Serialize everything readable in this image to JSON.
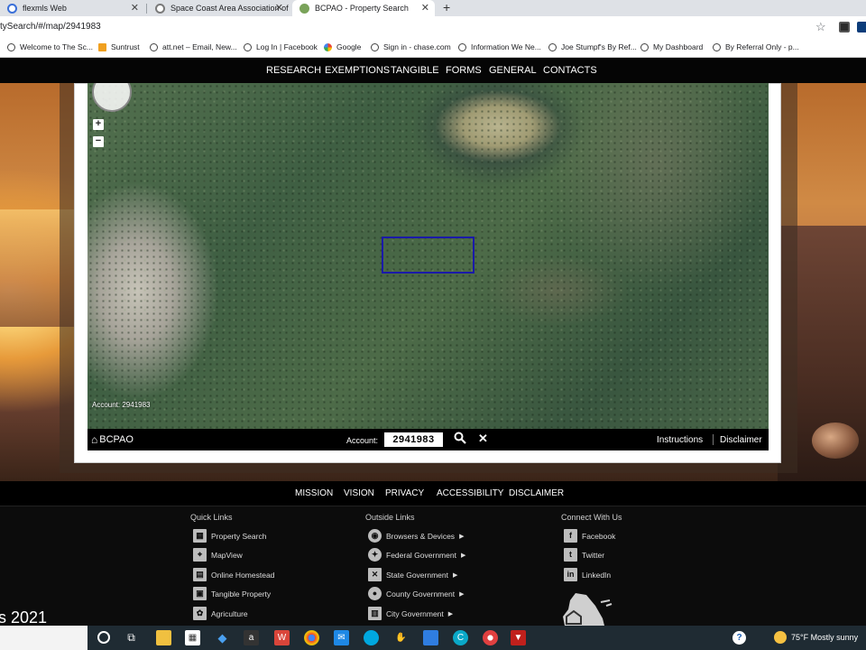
{
  "browser": {
    "tabs": [
      {
        "title": "flexmls Web",
        "active": false
      },
      {
        "title": "Space Coast Area Association of",
        "active": false
      },
      {
        "title": "BCPAO - Property Search",
        "active": true
      }
    ],
    "new_tab": "+",
    "url": "tySearch/#/map/2941983",
    "bookmarks": [
      {
        "label": "Welcome to The Sc...",
        "icon": "globe-icon"
      },
      {
        "label": "Suntrust",
        "icon": "suntrust-icon"
      },
      {
        "label": "att.net – Email, New...",
        "icon": "globe-icon"
      },
      {
        "label": "Log In | Facebook",
        "icon": "globe-icon"
      },
      {
        "label": "Google",
        "icon": "google-icon"
      },
      {
        "label": "Sign in - chase.com",
        "icon": "globe-icon"
      },
      {
        "label": "Information We Ne...",
        "icon": "globe-icon"
      },
      {
        "label": "Joe Stumpf's By Ref...",
        "icon": "globe-icon"
      },
      {
        "label": "My Dashboard",
        "icon": "globe-icon"
      },
      {
        "label": "By Referral Only - p...",
        "icon": "globe-icon"
      }
    ]
  },
  "site": {
    "nav": [
      "RESEARCH",
      "EXEMPTIONS",
      "TANGIBLE",
      "FORMS",
      "GENERAL",
      "CONTACTS"
    ],
    "map": {
      "account_overlay": "Account: 2941983",
      "zoom_in": "+",
      "zoom_out": "−"
    },
    "mapbar": {
      "home_label": "BCPAO",
      "account_label": "Account:",
      "account_value": "2941983",
      "instructions": "Instructions",
      "disclaimer": "Disclaimer"
    },
    "footer_nav": [
      "MISSION",
      "VISION",
      "PRIVACY",
      "ACCESSIBILITY",
      "DISCLAIMER"
    ],
    "footer": {
      "quick_links_title": "Quick Links",
      "quick_links": [
        "Property Search",
        "MapView",
        "Online Homestead",
        "Tangible Property",
        "Agriculture"
      ],
      "outside_links_title": "Outside Links",
      "outside_links": [
        "Browsers & Devices",
        "Federal Government",
        "State Government",
        "County Government",
        "City Government"
      ],
      "connect_title": "Connect With Us",
      "connect_links": [
        "Facebook",
        "Twitter",
        "LinkedIn"
      ],
      "year_text": "s 2021"
    }
  },
  "taskbar": {
    "weather": "75°F  Mostly sunny"
  },
  "colors": {
    "selection_outline": "#1a1aa8",
    "nav_bg": "#050505",
    "footer_bg": "#0c0c0c",
    "taskbar_bg": "#1f2b33"
  }
}
